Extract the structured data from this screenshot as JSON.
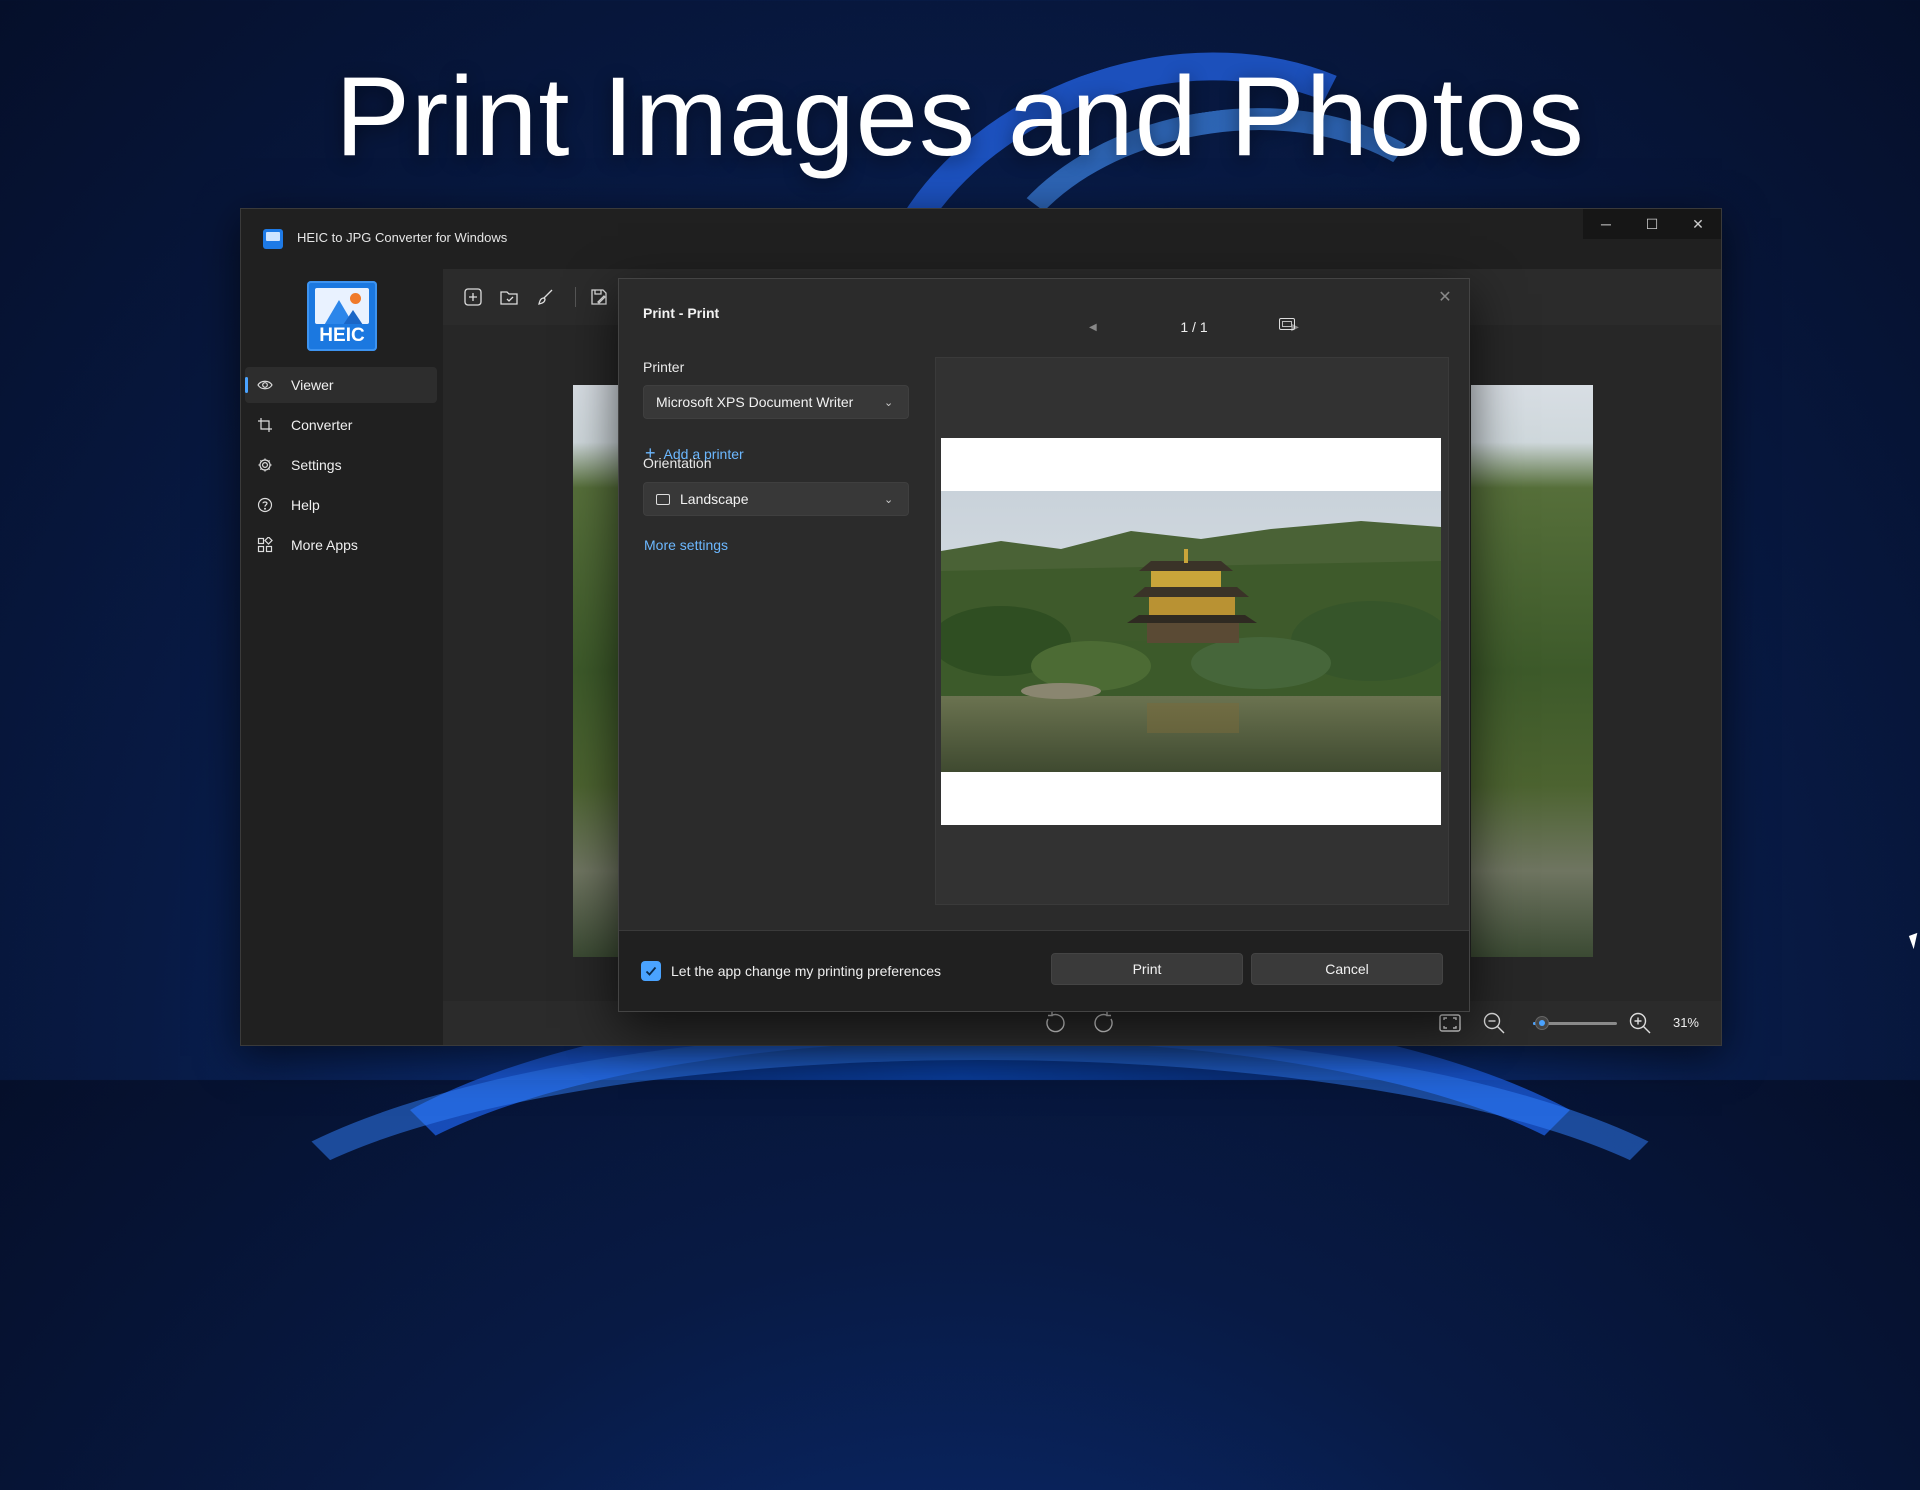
{
  "headline": "Print Images and Photos",
  "window": {
    "title": "HEIC to JPG Converter for Windows",
    "controls": {
      "minimize": "─",
      "maximize": "☐",
      "close": "✕"
    }
  },
  "sidebar": {
    "logo_text": "HEIC",
    "items": [
      {
        "label": "Viewer",
        "icon": "eye-icon",
        "active": true
      },
      {
        "label": "Converter",
        "icon": "crop-icon"
      },
      {
        "label": "Settings",
        "icon": "gear-icon"
      },
      {
        "label": "Help",
        "icon": "question-icon"
      },
      {
        "label": "More Apps",
        "icon": "apps-grid-icon"
      }
    ]
  },
  "toolbar": {
    "icons": [
      "add-image-icon",
      "open-folder-icon",
      "brush-icon",
      "save-as-icon"
    ]
  },
  "statusbar": {
    "zoom_value": 31,
    "zoom_text": "31%"
  },
  "print_dialog": {
    "title": "Print - Print",
    "close": "✕",
    "printer_label": "Printer",
    "printer_value": "Microsoft XPS Document Writer",
    "add_printer": "Add a printer",
    "orientation_label": "Orientation",
    "orientation_value": "Landscape",
    "more_settings": "More settings",
    "page_indicator": "1 / 1",
    "prev_arrow": "◀",
    "next_arrow": "▶",
    "checkbox_label": "Let the app change my printing preferences",
    "checkbox_checked": true,
    "print_button": "Print",
    "cancel_button": "Cancel"
  },
  "colors": {
    "accent": "#4aa3ff",
    "link": "#6cb8ff",
    "window_bg": "#202020",
    "dialog_bg": "#2b2b2b"
  }
}
